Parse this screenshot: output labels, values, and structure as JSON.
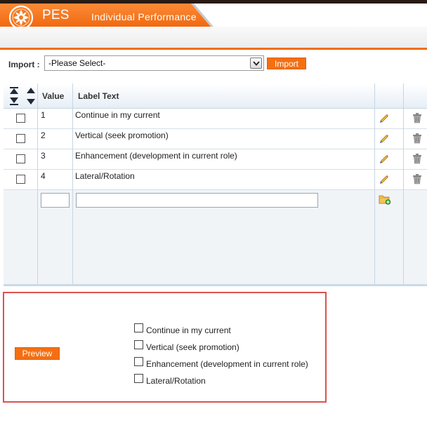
{
  "header": {
    "app_name": "PES",
    "app_subtitle": "Individual Performance",
    "logo_icon": "sunburst-logo-icon"
  },
  "import": {
    "label": "Import :",
    "select_value": "-Please Select-",
    "button_label": "Import"
  },
  "grid": {
    "columns": [
      "",
      "Value",
      "Label Text",
      "",
      ""
    ],
    "rows": [
      {
        "value": "1",
        "label": "Continue in my current"
      },
      {
        "value": "2",
        "label": "Vertical (seek promotion)"
      },
      {
        "value": "3",
        "label": "Enhancement (development in current role)"
      },
      {
        "value": "4",
        "label": "Lateral/Rotation"
      }
    ],
    "new_row": {
      "value": "",
      "label": ""
    },
    "icons": {
      "move_top": "move-to-top-icon",
      "move_bottom": "move-to-bottom-icon",
      "move_up": "move-up-icon",
      "move_down": "move-down-icon",
      "edit": "pencil-icon",
      "delete": "trash-icon",
      "add": "folder-add-icon"
    }
  },
  "preview": {
    "button_label": "Preview",
    "options": [
      "Continue in my current",
      "Vertical (seek promotion)",
      "Enhancement (development in current role)",
      "Lateral/Rotation"
    ]
  },
  "colors": {
    "brand_orange": "#f46f12",
    "header_dark": "#2a1a14",
    "grid_border": "#c7d5e2",
    "preview_border": "#d9534f"
  }
}
